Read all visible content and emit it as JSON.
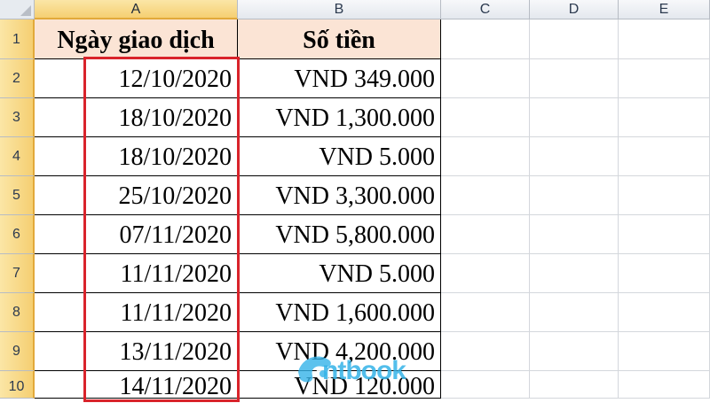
{
  "columns": [
    "A",
    "B",
    "C",
    "D",
    "E"
  ],
  "rows": [
    "1",
    "2",
    "3",
    "4",
    "5",
    "6",
    "7",
    "8",
    "9",
    "10"
  ],
  "header": {
    "date_label": "Ngày giao dịch",
    "amount_label": "Số tiền"
  },
  "dates": [
    "12/10/2020",
    "18/10/2020",
    "18/10/2020",
    "25/10/2020",
    "07/11/2020",
    "11/11/2020",
    "11/11/2020",
    "13/11/2020",
    "14/11/2020"
  ],
  "amounts": [
    "VND 349.000",
    "VND 1,300.000",
    "VND 5.000",
    "VND 3,300.000",
    "VND 5,800.000",
    "VND 5.000",
    "VND 1,600.000",
    "VND 4,200.000",
    "VND 120.000"
  ],
  "watermark": "ntbook",
  "colors": {
    "highlight": "#d9232b",
    "header_fill": "#fbe4d5",
    "selected_header": "#f5cf72"
  }
}
